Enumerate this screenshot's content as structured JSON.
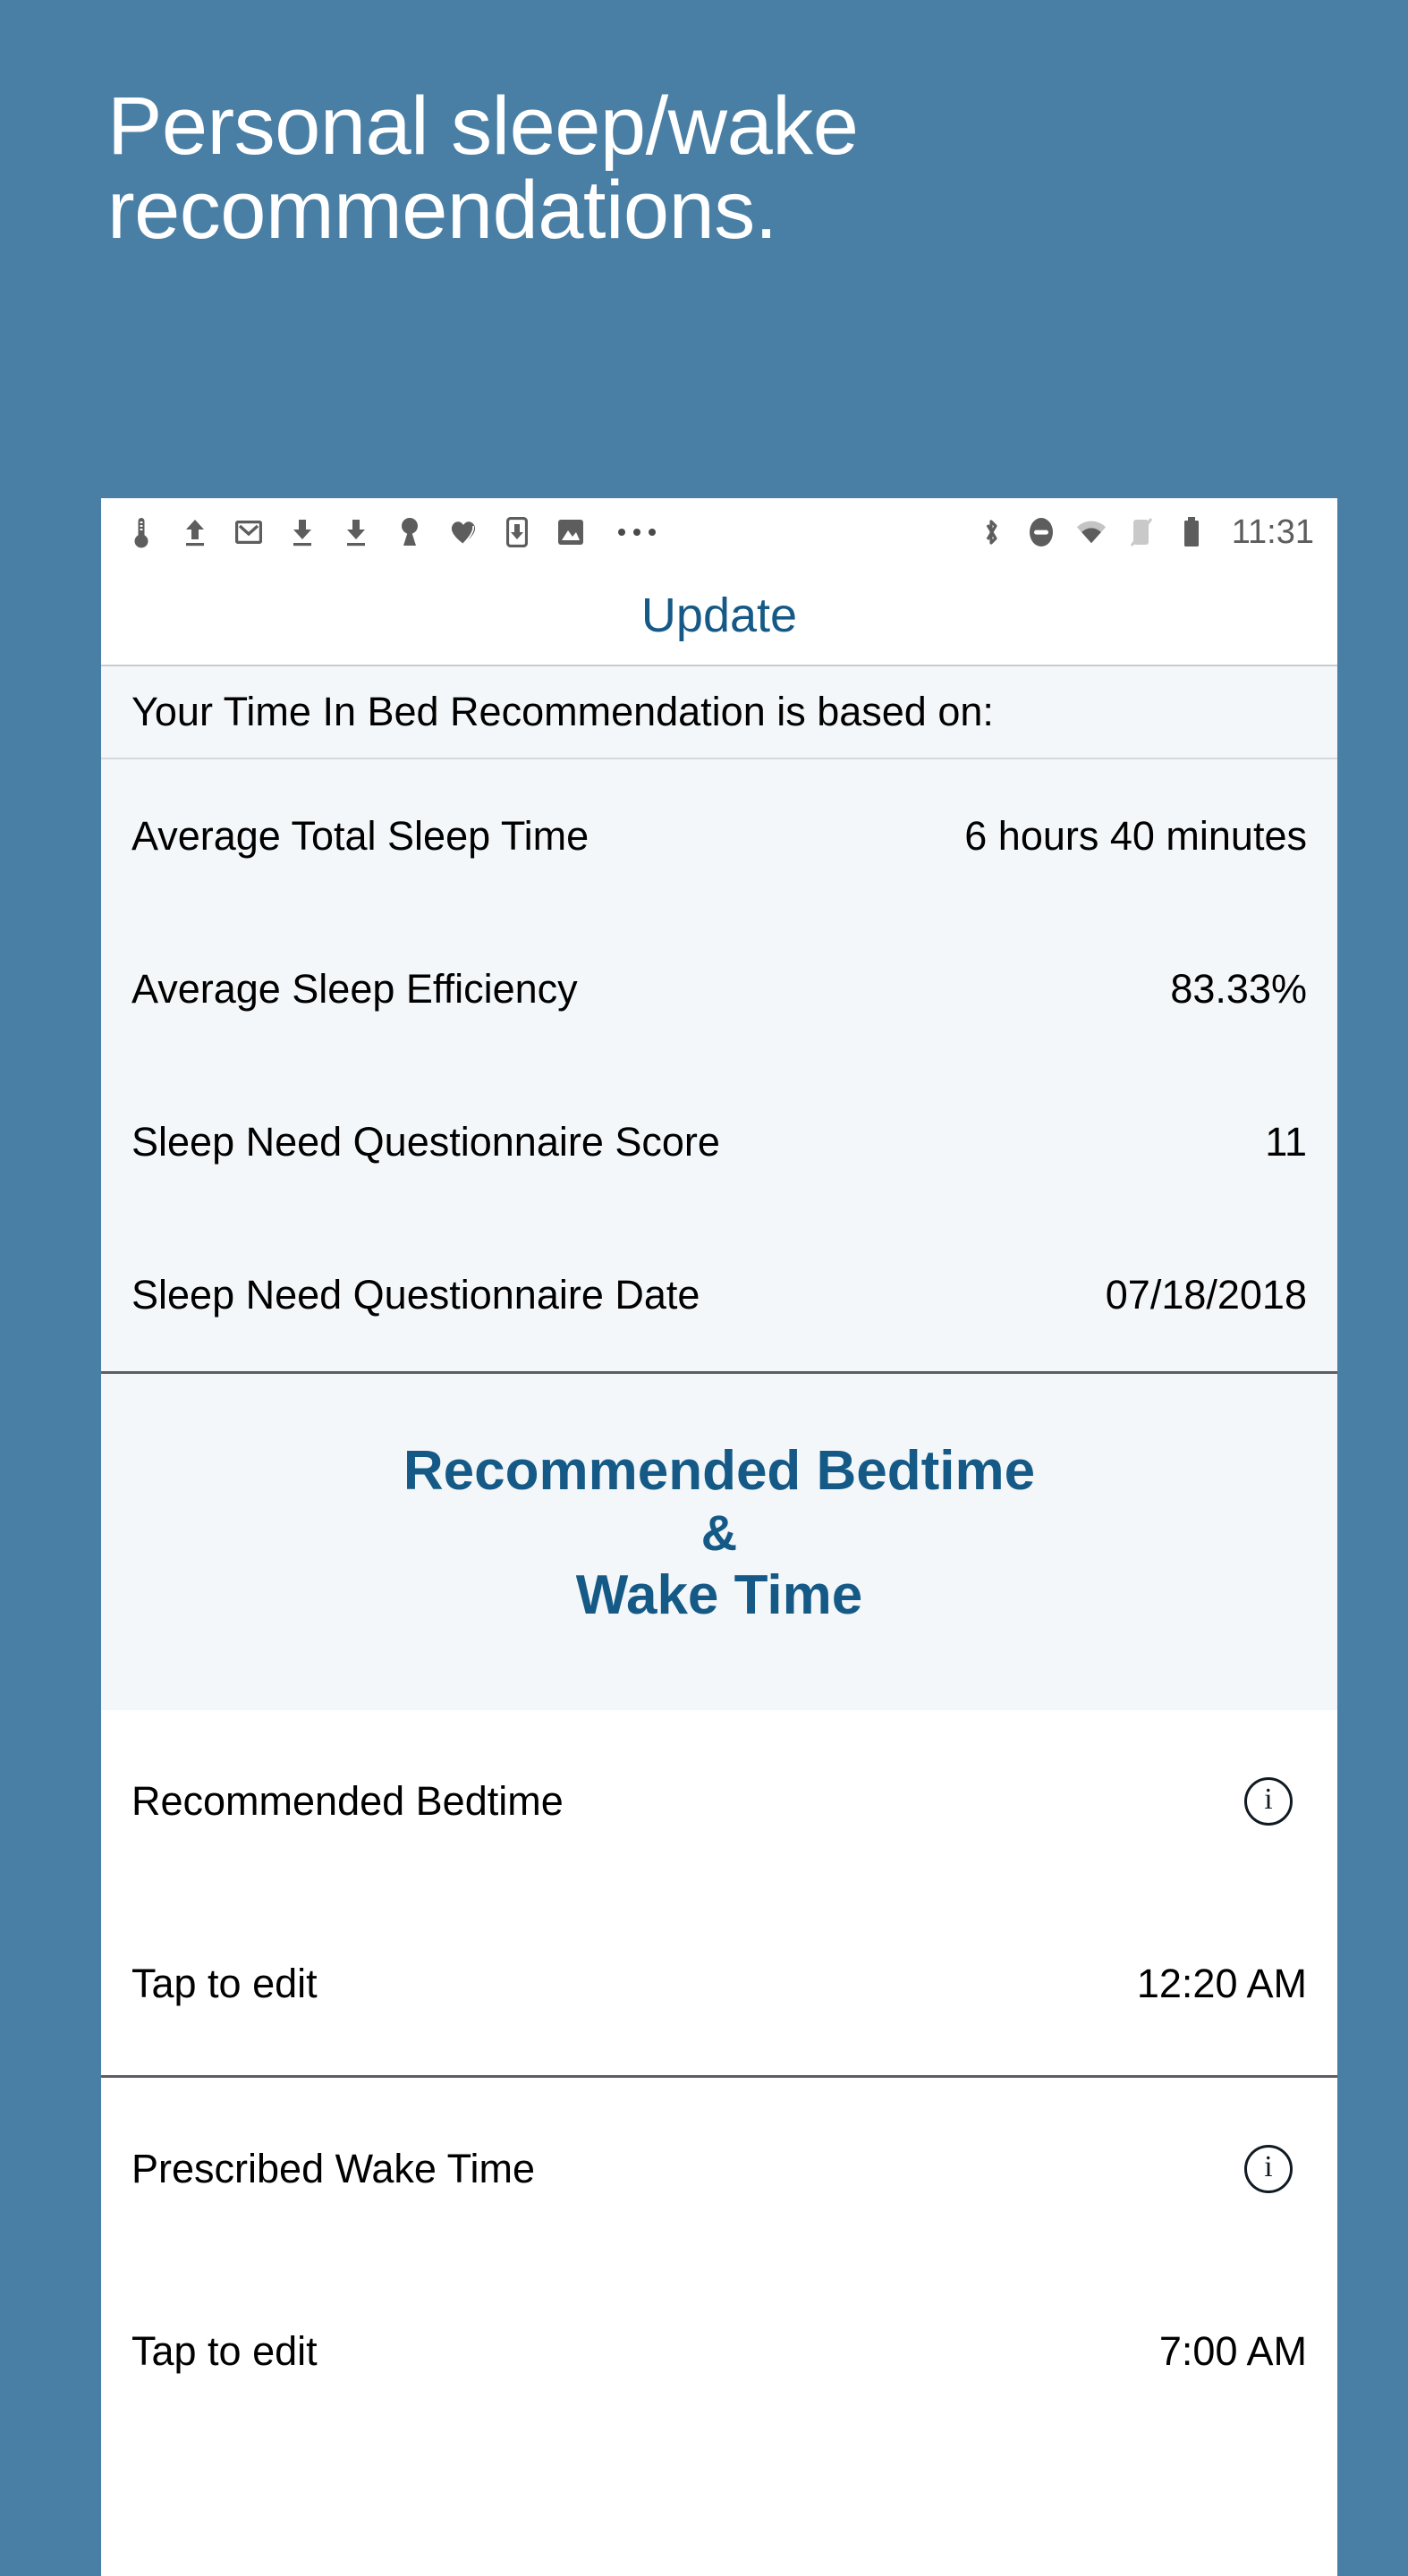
{
  "hero": {
    "title": "Personal sleep/wake\nrecommendations."
  },
  "theme": {
    "background_blue": "#4a7fa5",
    "accent_blue": "#155a87",
    "panel_background": "#ffffff",
    "section_background": "#f4f7f9",
    "text_black": "#000000",
    "status_icon_gray": "#5d5d5d"
  },
  "phone": {
    "statusbar": {
      "left_icons": [
        "thermometer-icon",
        "upload-icon",
        "gmail-icon",
        "download-icon",
        "download-icon",
        "keyhole-icon",
        "heart-icon",
        "phone-download-icon",
        "image-icon"
      ],
      "overflow_icon": "more-dots-icon",
      "right_icons": [
        "bluetooth-icon",
        "do-not-disturb-icon",
        "wifi-icon",
        "silent-mode-icon",
        "battery-icon"
      ],
      "clock": "11:31"
    },
    "navbar": {
      "title": "Update"
    },
    "basis_section": {
      "header": "Your Time In Bed Recommendation is based on:",
      "rows": [
        {
          "label": "Average Total Sleep Time",
          "value": "6 hours 40 minutes"
        },
        {
          "label": "Average Sleep Efficiency",
          "value": "83.33%"
        },
        {
          "label": "Sleep Need Questionnaire Score",
          "value": "11"
        },
        {
          "label": "Sleep Need Questionnaire Date",
          "value": "07/18/2018"
        }
      ]
    },
    "headline": {
      "line1": "Recommended Bedtime",
      "line2": "&",
      "line3": "Wake Time"
    },
    "bedtime": {
      "label": "Recommended Bedtime",
      "info_icon": "info-icon",
      "edit_label": "Tap to edit",
      "value": "12:20 AM"
    },
    "waketime": {
      "label": "Prescribed Wake Time",
      "info_icon": "info-icon",
      "edit_label": "Tap to edit",
      "value": "7:00 AM"
    }
  }
}
